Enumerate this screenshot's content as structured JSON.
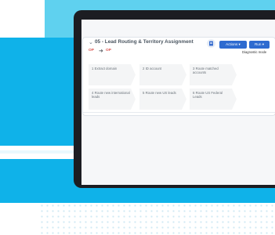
{
  "workflow": {
    "collapse_glyph": "⌄",
    "title": "05 - Lead Routing & Territory Assignment",
    "status_from": "OP",
    "status_arrow": "➜",
    "status_to": "OP",
    "actions_label": "Actions ▾",
    "run_label": "Run ▾",
    "mode_label": "Diagnostic mode",
    "steps": [
      {
        "label": "1  Extract domain"
      },
      {
        "label": "2  ID account"
      },
      {
        "label": "3  Route matched accounts"
      },
      {
        "label": "4  Route new international leads"
      },
      {
        "label": "5  Route new US leads"
      },
      {
        "label": "6  Route US Federal Leads"
      }
    ]
  },
  "colors": {
    "brand_light_blue": "#5fd1ef",
    "brand_blue": "#0fb2e9",
    "button_blue": "#2e6bd0",
    "status_red": "#d9534f"
  },
  "icons": {
    "note": "note-icon",
    "collapse": "chevron-down-icon",
    "arrow": "arrow-right-icon"
  }
}
